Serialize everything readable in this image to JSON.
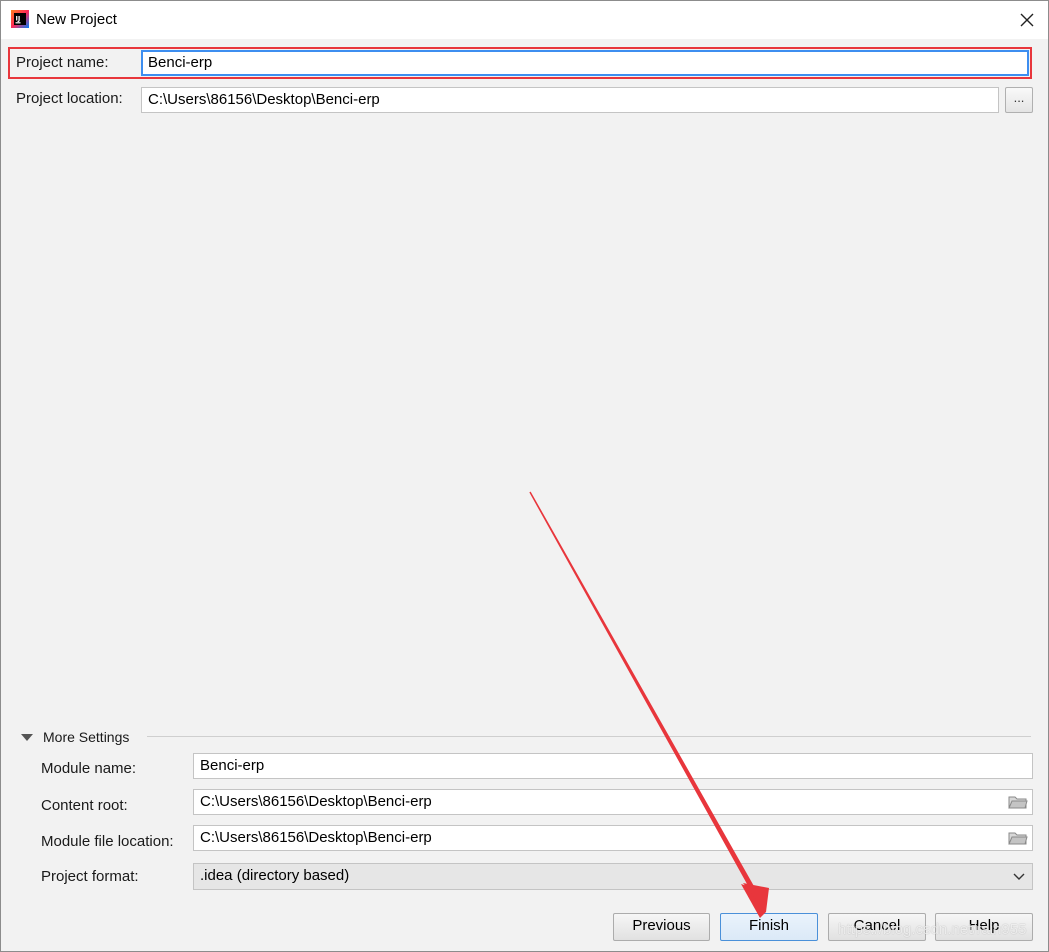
{
  "window": {
    "title": "New Project",
    "app_icon": "intellij-idea-icon",
    "close_icon": "close-icon"
  },
  "project": {
    "name_label": "Project name:",
    "name_value": "Benci-erp",
    "location_label": "Project location:",
    "location_value": "C:\\Users\\86156\\Desktop\\Benci-erp",
    "browse_label": "..."
  },
  "more_settings": {
    "title": "More Settings",
    "module_name_label": "Module name:",
    "module_name_value": "Benci-erp",
    "content_root_label": "Content root:",
    "content_root_value": "C:\\Users\\86156\\Desktop\\Benci-erp",
    "module_file_label": "Module file location:",
    "module_file_value": "C:\\Users\\86156\\Desktop\\Benci-erp",
    "format_label": "Project format:",
    "format_value": ".idea (directory based)"
  },
  "buttons": {
    "previous": "Previous",
    "finish": "Finish",
    "cancel": "Cancel",
    "help": "Help"
  },
  "annotation": {
    "highlight_color": "#e8363c",
    "arrow_color": "#e8363c"
  },
  "watermark": "https://blog.csdn.net/rain955"
}
